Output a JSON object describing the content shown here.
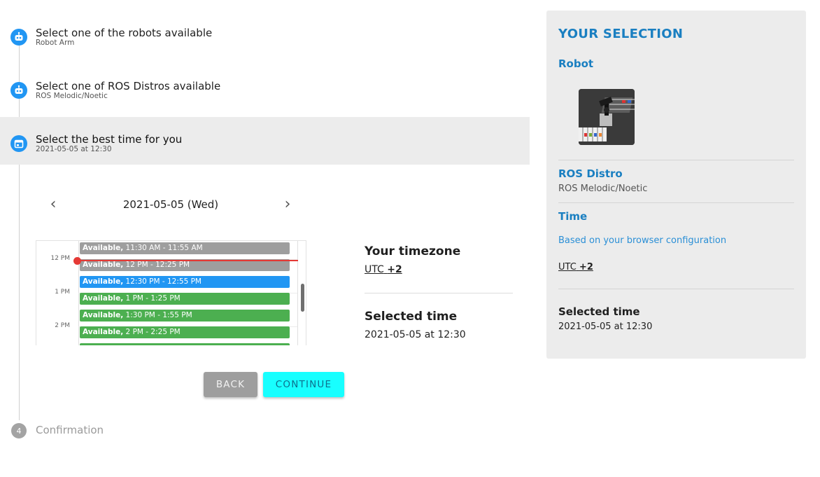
{
  "steps": [
    {
      "title": "Select one of the robots available",
      "subtitle": "Robot Arm",
      "icon": "robot-icon",
      "state": "done"
    },
    {
      "title": "Select one of ROS Distros available",
      "subtitle": "ROS Melodic/Noetic",
      "icon": "robot-icon",
      "state": "done"
    },
    {
      "title": "Select the best time for you",
      "subtitle": "2021-05-05 at 12:30",
      "icon": "calendar-icon",
      "state": "active"
    },
    {
      "number": "4",
      "title": "Confirmation",
      "state": "pending"
    }
  ],
  "date_nav": {
    "prev_icon": "chevron-left-icon",
    "date_label": "2021-05-05 (Wed)",
    "next_icon": "chevron-right-icon"
  },
  "calendar": {
    "hour_labels": [
      "12 PM",
      "1 PM",
      "2 PM"
    ],
    "slots": [
      {
        "status": "Available,",
        "time": "11:30 AM - 11:55 AM",
        "color": "gray"
      },
      {
        "status": "Available,",
        "time": "12 PM - 12:25 PM",
        "color": "gray"
      },
      {
        "status": "Available,",
        "time": "12:30 PM - 12:55 PM",
        "color": "blue"
      },
      {
        "status": "Available,",
        "time": "1 PM - 1:25 PM",
        "color": "green"
      },
      {
        "status": "Available,",
        "time": "1:30 PM - 1:55 PM",
        "color": "green"
      },
      {
        "status": "Available,",
        "time": "2 PM - 2:25 PM",
        "color": "green"
      },
      {
        "status": "",
        "time": "",
        "color": "green"
      }
    ],
    "colors": {
      "gray": "#9e9e9e",
      "blue": "#2196f3",
      "green": "#4caf50",
      "now": "#e53935"
    }
  },
  "timezone": {
    "heading": "Your timezone",
    "prefix": "UTC",
    "offset": "+2"
  },
  "selected": {
    "heading": "Selected time",
    "value": "2021-05-05 at 12:30"
  },
  "buttons": {
    "back_label": "BACK",
    "continue_label": "CONTINUE"
  },
  "summary": {
    "title": "YOUR SELECTION",
    "robot_label": "Robot",
    "ros_label": "ROS Distro",
    "ros_value": "ROS Melodic/Noetic",
    "time_label": "Time",
    "time_note": "Based on your browser configuration",
    "tz_prefix": "UTC",
    "tz_offset": "+2",
    "selected_heading": "Selected time",
    "selected_value": "2021-05-05 at 12:30"
  },
  "theme": {
    "accent": "#1a7fc1",
    "step_icon": "#2196f3",
    "continue_bg": "#18ffff",
    "panel_bg": "#ececec"
  }
}
